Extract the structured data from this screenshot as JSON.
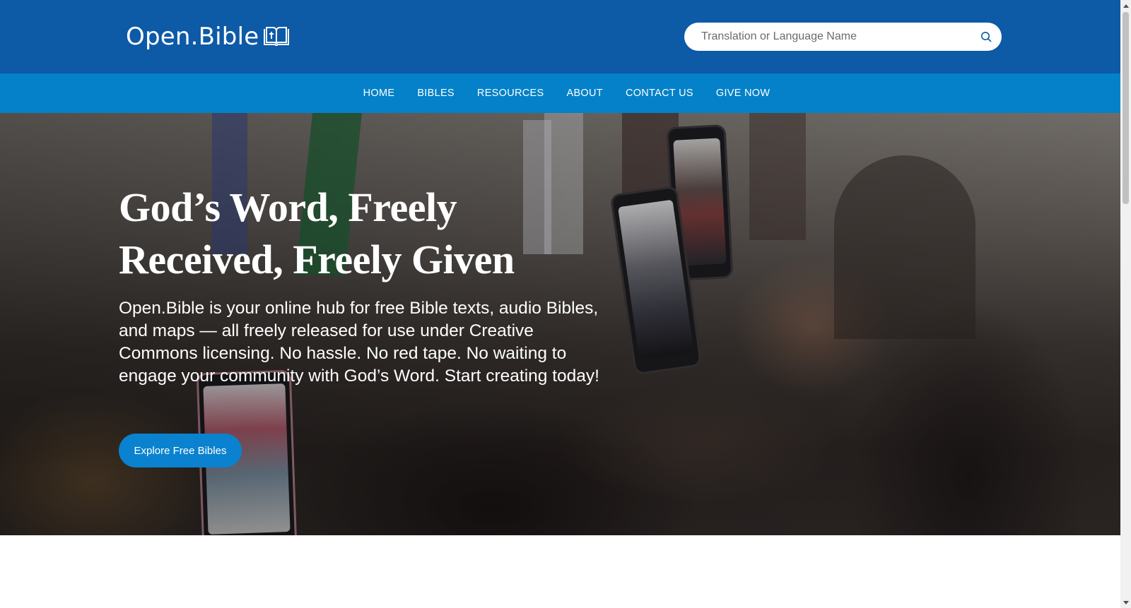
{
  "header": {
    "logo_text": "Open.Bible",
    "logo_icon": "open-book-cross-icon",
    "search": {
      "placeholder": "Translation or Language Name",
      "value": "",
      "icon": "search-icon"
    }
  },
  "nav": {
    "items": [
      {
        "label": "HOME"
      },
      {
        "label": "BIBLES"
      },
      {
        "label": "RESOURCES"
      },
      {
        "label": "ABOUT"
      },
      {
        "label": "CONTACT US"
      },
      {
        "label": "GIVE NOW"
      }
    ]
  },
  "hero": {
    "title": "God’s Word, Freely Received, Freely Given",
    "description": "Open.Bible is your online hub for free Bible texts, audio Bibles, and maps — all freely released for use under Creative Commons licensing. No hassle. No red tape. No waiting to engage your community with God’s Word. Start creating today!",
    "cta_label": "Explore Free Bibles"
  },
  "colors": {
    "header_bg": "#0d5aa7",
    "nav_bg": "#0481c9",
    "cta_bg": "#0a82cf",
    "text_light": "#ffffff"
  }
}
